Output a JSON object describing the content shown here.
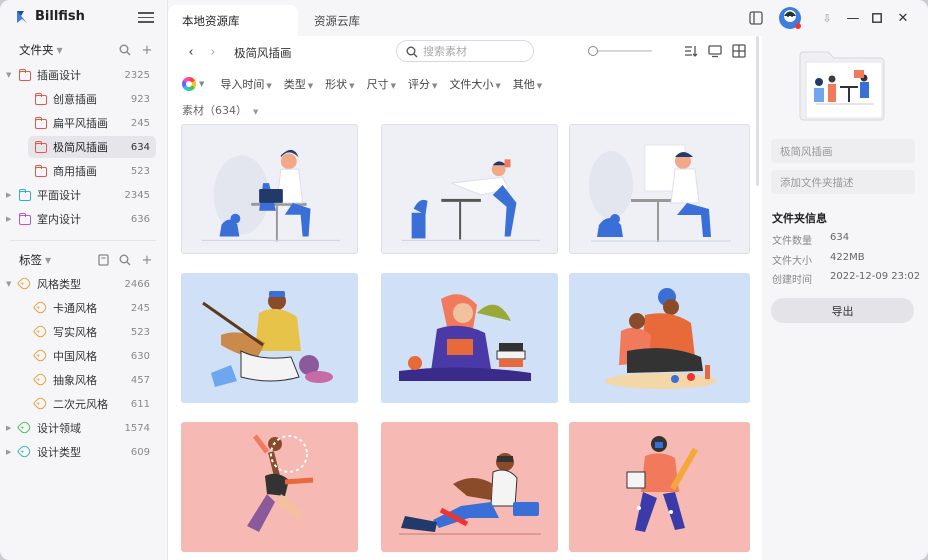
{
  "app": {
    "name": "Billfish"
  },
  "tabs": [
    {
      "label": "本地资源库"
    },
    {
      "label": "资源云库"
    }
  ],
  "sidebar": {
    "folders_title": "文件夹",
    "folders": [
      {
        "label": "插画设计",
        "count": "2325",
        "color": "#e05a4a",
        "expanded": true
      },
      {
        "label": "创意插画",
        "count": "923",
        "color": "#e05a4a"
      },
      {
        "label": "扁平风插画",
        "count": "245",
        "color": "#e05a4a"
      },
      {
        "label": "极简风插画",
        "count": "634",
        "color": "#e05a4a",
        "selected": true
      },
      {
        "label": "商用插画",
        "count": "523",
        "color": "#e05a4a"
      },
      {
        "label": "平面设计",
        "count": "2345",
        "color": "#3aa8e0"
      },
      {
        "label": "室内设计",
        "count": "636",
        "color": "#b05ad8"
      }
    ],
    "tags_title": "标签",
    "tags": [
      {
        "label": "风格类型",
        "count": "2466",
        "color": "#e8a13a",
        "expanded": true
      },
      {
        "label": "卡通风格",
        "count": "245",
        "color": "#e8a13a"
      },
      {
        "label": "写实风格",
        "count": "523",
        "color": "#e8a13a"
      },
      {
        "label": "中国风格",
        "count": "630",
        "color": "#e8a13a"
      },
      {
        "label": "抽象风格",
        "count": "457",
        "color": "#e8a13a"
      },
      {
        "label": "二次元风格",
        "count": "611",
        "color": "#e8a13a"
      },
      {
        "label": "设计领域",
        "count": "1574",
        "color": "#4cbf5a"
      },
      {
        "label": "设计类型",
        "count": "609",
        "color": "#3ab8b0"
      }
    ]
  },
  "main": {
    "breadcrumb": "极简风插画",
    "search_placeholder": "搜索素材",
    "filters": [
      "导入时间",
      "类型",
      "形状",
      "尺寸",
      "评分",
      "文件大小",
      "其他"
    ],
    "count_label": "素材（634）"
  },
  "cards": [
    {
      "bg": "#eef0f5",
      "theme": "laptop-dog"
    },
    {
      "bg": "#eef0f5",
      "theme": "yoga"
    },
    {
      "bg": "#eef0f5",
      "theme": "laptop-cat"
    },
    {
      "bg": "#cfe0f7",
      "theme": "guitar"
    },
    {
      "bg": "#cfe0f7",
      "theme": "reading"
    },
    {
      "bg": "#cfe0f7",
      "theme": "picnic"
    },
    {
      "bg": "#f6b9b3",
      "theme": "dance"
    },
    {
      "bg": "#f6b9b3",
      "theme": "sitting"
    },
    {
      "bg": "#f6b9b3",
      "theme": "pencil"
    }
  ],
  "panel": {
    "name_value": "极简风插画",
    "desc_placeholder": "添加文件夹描述",
    "info_title": "文件夹信息",
    "info": [
      {
        "label": "文件数量",
        "value": "634"
      },
      {
        "label": "文件大小",
        "value": "422MB"
      },
      {
        "label": "创建时间",
        "value": "2022-12-09 23:02"
      }
    ],
    "export_label": "导出"
  },
  "colors": {
    "accent": "#3b7de0",
    "sidebar": "#f6f6f8",
    "selected": "#e6e6ea"
  }
}
